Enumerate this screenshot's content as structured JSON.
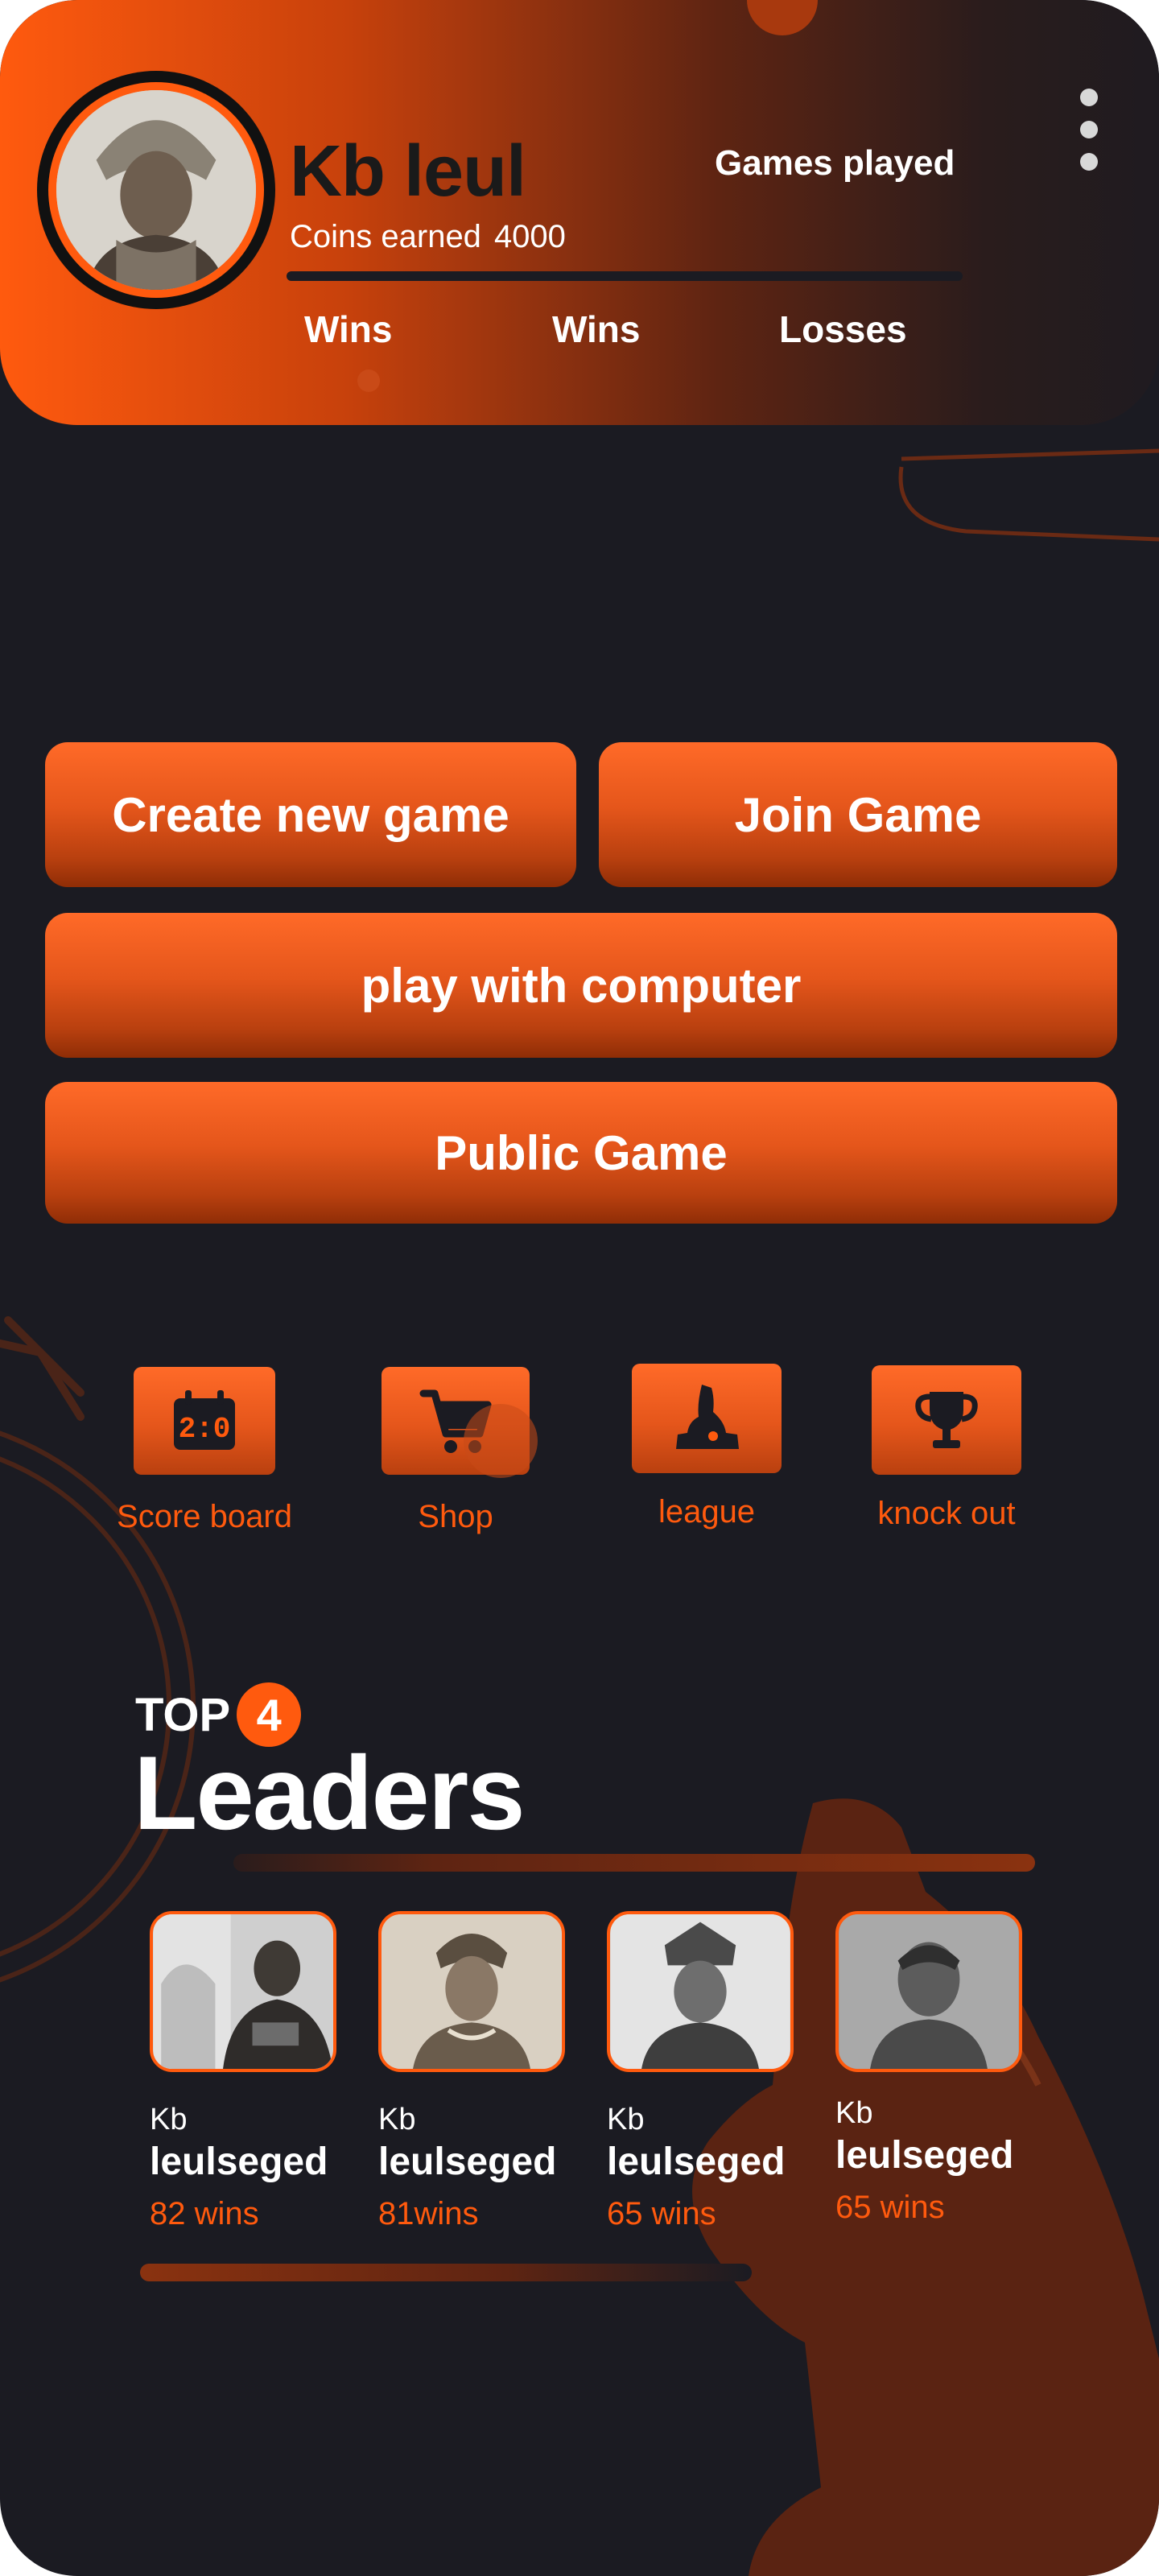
{
  "profile": {
    "name": "Kb leul",
    "coins_label": "Coins earned",
    "coins_value": "4000",
    "games_played_label": "Games played",
    "stats": [
      "Wins",
      "Wins",
      "Losses"
    ]
  },
  "actions": {
    "create": "Create new game",
    "join": "Join Game",
    "computer": "play with computer",
    "public": "Public Game"
  },
  "nav": [
    {
      "label": "Score board",
      "icon": "scoreboard-icon"
    },
    {
      "label": "Shop",
      "icon": "cart-icon"
    },
    {
      "label": "league",
      "icon": "chess-knight-icon"
    },
    {
      "label": "knock out",
      "icon": "trophy-icon"
    }
  ],
  "leaders": {
    "top_prefix": "TOP",
    "top_count": "4",
    "title": "Leaders",
    "items": [
      {
        "first": "Kb",
        "last": "leulseged",
        "wins": "82 wins"
      },
      {
        "first": "Kb",
        "last": "leulseged",
        "wins": " 81wins"
      },
      {
        "first": "Kb",
        "last": "leulseged",
        "wins": "65 wins"
      },
      {
        "first": "Kb",
        "last": "leulseged",
        "wins": "65 wins"
      }
    ]
  },
  "colors": {
    "accent": "#ff5a0e",
    "background": "#1b1b22",
    "deco": "#6a2a14"
  }
}
